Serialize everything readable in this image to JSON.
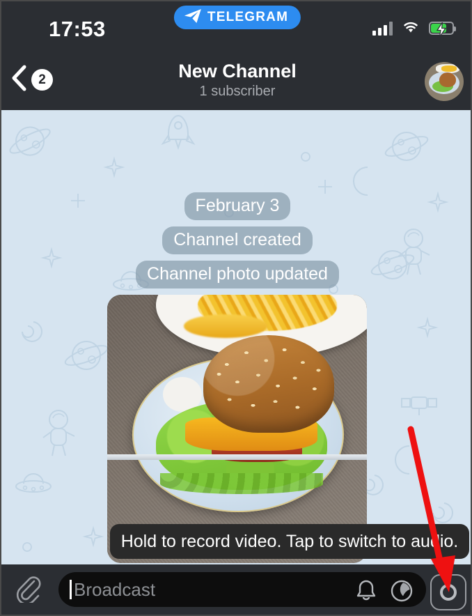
{
  "status_bar": {
    "time": "17:53",
    "brand_pill": {
      "label": "TELEGRAM",
      "icon": "paper-plane-icon",
      "color": "#2d8cf0"
    },
    "signal_icon": "cellular-signal-icon",
    "wifi_icon": "wifi-icon",
    "battery_icon": "battery-charging-icon",
    "battery_color": "#3bd44b"
  },
  "nav": {
    "back_icon": "chevron-left-icon",
    "unread_badge": "2",
    "title": "New Channel",
    "subtitle": "1 subscriber",
    "avatar_name": "channel-avatar"
  },
  "chat": {
    "background_color": "#d6e4f0",
    "service_messages": [
      "February 3",
      "Channel created",
      "Channel photo updated"
    ],
    "photo_message": {
      "alt": "burger-on-plate-photo"
    }
  },
  "tooltip": {
    "text": "Hold to record video. Tap to switch to audio."
  },
  "input_bar": {
    "attach_icon": "paperclip-icon",
    "placeholder": "Broadcast",
    "value": "",
    "mute_icon": "bell-icon",
    "theme_icon": "sticker-circle-icon",
    "record_icon": "video-message-camera-icon"
  },
  "annotation": {
    "arrow_color": "#ee1111",
    "points_to": "video-message-camera-icon"
  }
}
